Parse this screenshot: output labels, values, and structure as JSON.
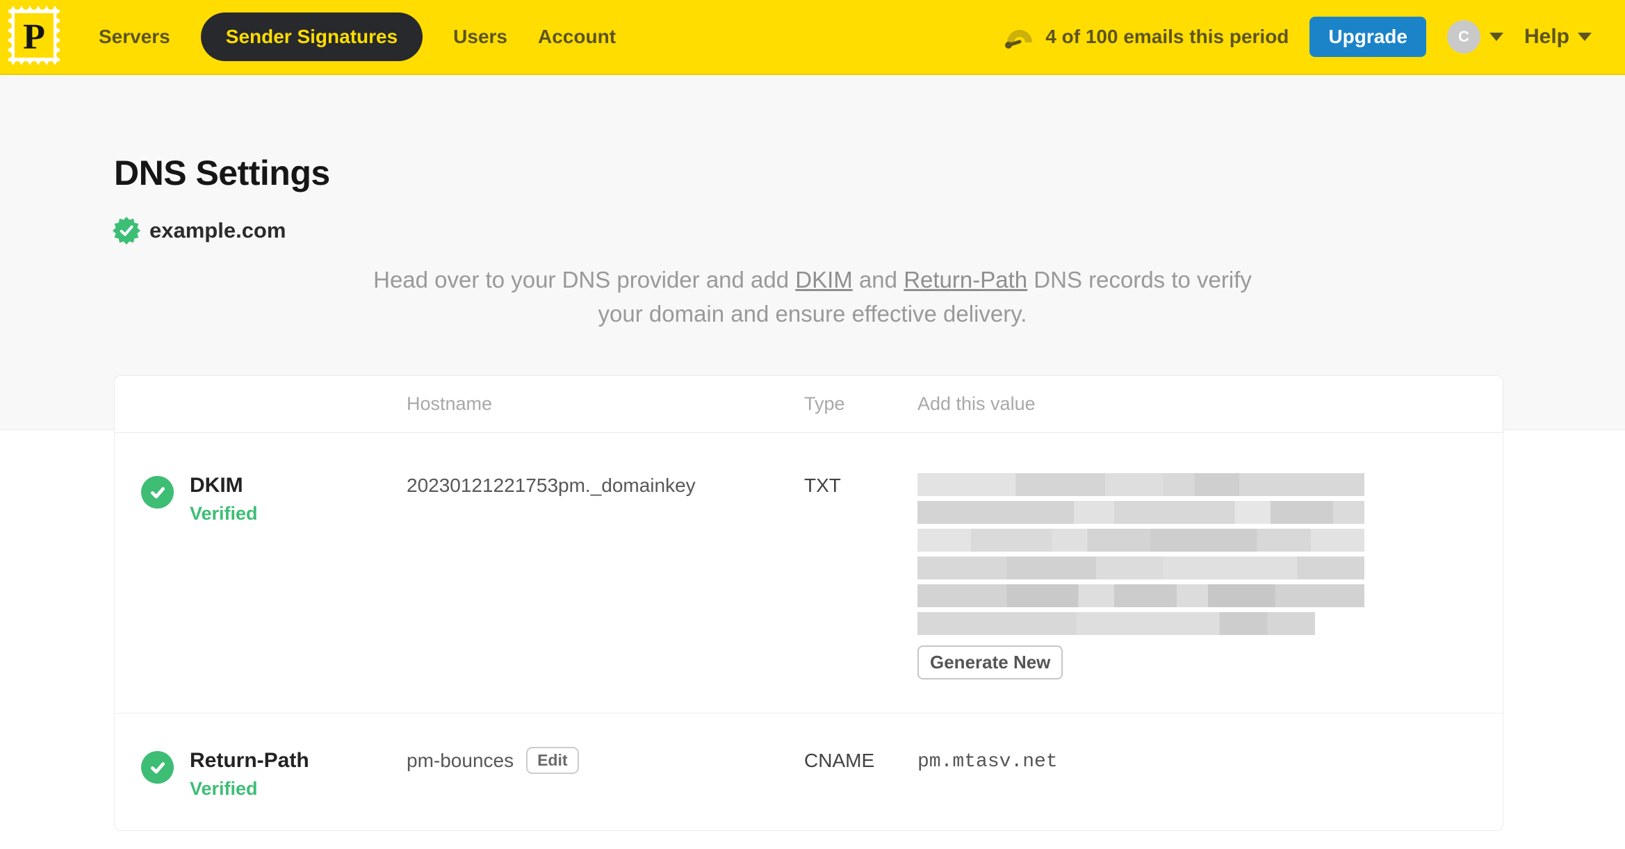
{
  "nav": {
    "brand_letter": "P",
    "items": [
      {
        "label": "Servers",
        "active": false
      },
      {
        "label": "Sender Signatures",
        "active": true
      },
      {
        "label": "Users",
        "active": false
      },
      {
        "label": "Account",
        "active": false
      }
    ],
    "usage_text": "4 of 100 emails this period",
    "upgrade_label": "Upgrade",
    "avatar_initial": "C",
    "help_label": "Help"
  },
  "page": {
    "title": "DNS Settings",
    "domain": "example.com",
    "instructions": {
      "prefix": "Head over to your DNS provider and add ",
      "dkim_link": "DKIM",
      "and_text": " and ",
      "returnpath_link": "Return-Path",
      "suffix": " DNS records to verify your domain and ensure effective delivery."
    }
  },
  "table": {
    "headers": {
      "hostname": "Hostname",
      "type": "Type",
      "value": "Add this value"
    },
    "rows": [
      {
        "name": "DKIM",
        "status": "Verified",
        "hostname": "20230121221753pm._domainkey",
        "type": "TXT",
        "value": "[redacted]",
        "action_label": "Generate New"
      },
      {
        "name": "Return-Path",
        "status": "Verified",
        "hostname": "pm-bounces",
        "edit_label": "Edit",
        "type": "CNAME",
        "value": "pm.mtasv.net"
      }
    ]
  },
  "colors": {
    "brand_yellow": "#FFDD00",
    "nav_text_olive": "#5D5420",
    "active_pill_bg": "#27292C",
    "upgrade_blue": "#1B84C9",
    "verified_green": "#3DBE75",
    "muted_text": "#999999"
  }
}
